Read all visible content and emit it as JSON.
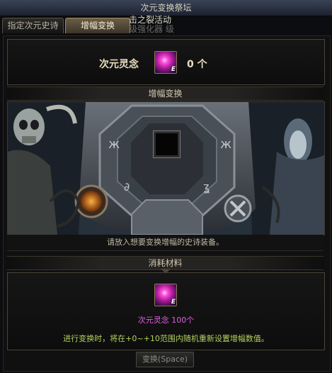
{
  "window": {
    "title": "次元变换祭坛"
  },
  "tabs": [
    {
      "label": "指定次元史诗"
    },
    {
      "label": "增幅变换"
    }
  ],
  "overlay": {
    "line1": "击之裂活动",
    "line2": "级强化器 级"
  },
  "resource": {
    "label": "次元灵念",
    "count": "0 个",
    "icon": "dimension-spirit-gem-icon"
  },
  "transform": {
    "header": "增幅变换",
    "hint": "请放入想要变换增幅的史诗装备。"
  },
  "materials": {
    "header": "消耗材料",
    "item_label": "次元灵念 100个",
    "info": "进行变换时，将在+0~+10范围内随机重新设置增幅数值。",
    "button": "变换(Space)"
  }
}
